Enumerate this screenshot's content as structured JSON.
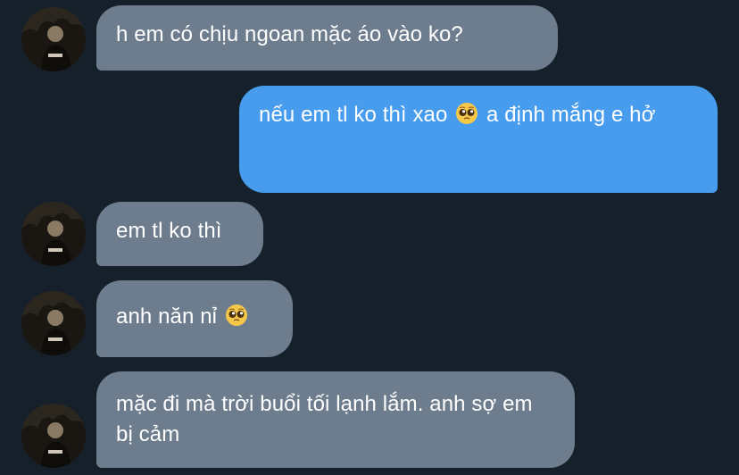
{
  "conversation": {
    "messages": [
      {
        "direction": "incoming",
        "text": "h em có chịu ngoan mặc áo vào ko?"
      },
      {
        "direction": "outgoing",
        "text_before_emoji": "nếu em tl ko thì xao ",
        "emoji": "pleading-face",
        "text_after_emoji": " a định mắng e hở"
      },
      {
        "direction": "incoming",
        "text": "em tl ko thì"
      },
      {
        "direction": "incoming",
        "text_before_emoji": "anh năn nỉ ",
        "emoji": "pleading-face"
      },
      {
        "direction": "incoming",
        "text": "mặc đi mà trời buổi tối lạnh lắm. anh sợ em bị cảm"
      }
    ]
  },
  "colors": {
    "background": "#15202b",
    "incoming_bubble": "#6e7d8d",
    "outgoing_bubble": "#479ced",
    "text": "#ffffff"
  }
}
